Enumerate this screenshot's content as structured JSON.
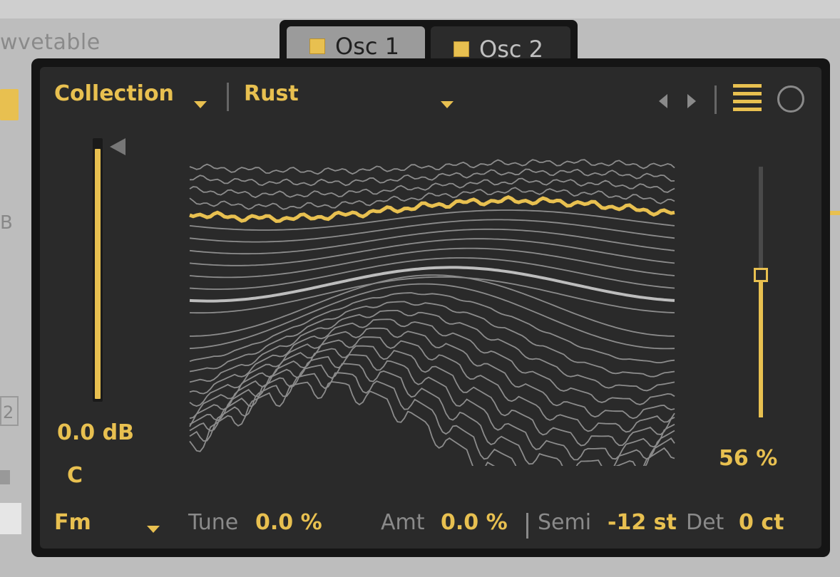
{
  "background": {
    "device_title": "wvetable",
    "left_label_b": "B",
    "left_box_value": "2"
  },
  "tabs": [
    {
      "label": "Osc 1",
      "active": false
    },
    {
      "label": "Osc 2",
      "active": true
    }
  ],
  "header": {
    "collection_label": "Collection",
    "wavetable_name": "Rust",
    "icons": [
      "prev-arrow-icon",
      "next-arrow-icon",
      "list-icon",
      "circle-icon"
    ]
  },
  "gain": {
    "value_label": "0.0 dB",
    "note": "C",
    "fill_fraction": 0.97
  },
  "position": {
    "value_label": "56 %",
    "fraction": 0.56
  },
  "footer": {
    "mod_mode": "Fm",
    "tune_label": "Tune",
    "tune_value": "0.0 %",
    "amt_label": "Amt",
    "amt_value": "0.0 %",
    "semi_label": "Semi",
    "semi_value": "-12 st",
    "det_label": "Det",
    "det_value": "0 ct"
  },
  "colors": {
    "accent": "#e8c050",
    "panel": "#2a2a2a",
    "frame": "#151515",
    "muted_text": "#8a8a8a"
  }
}
